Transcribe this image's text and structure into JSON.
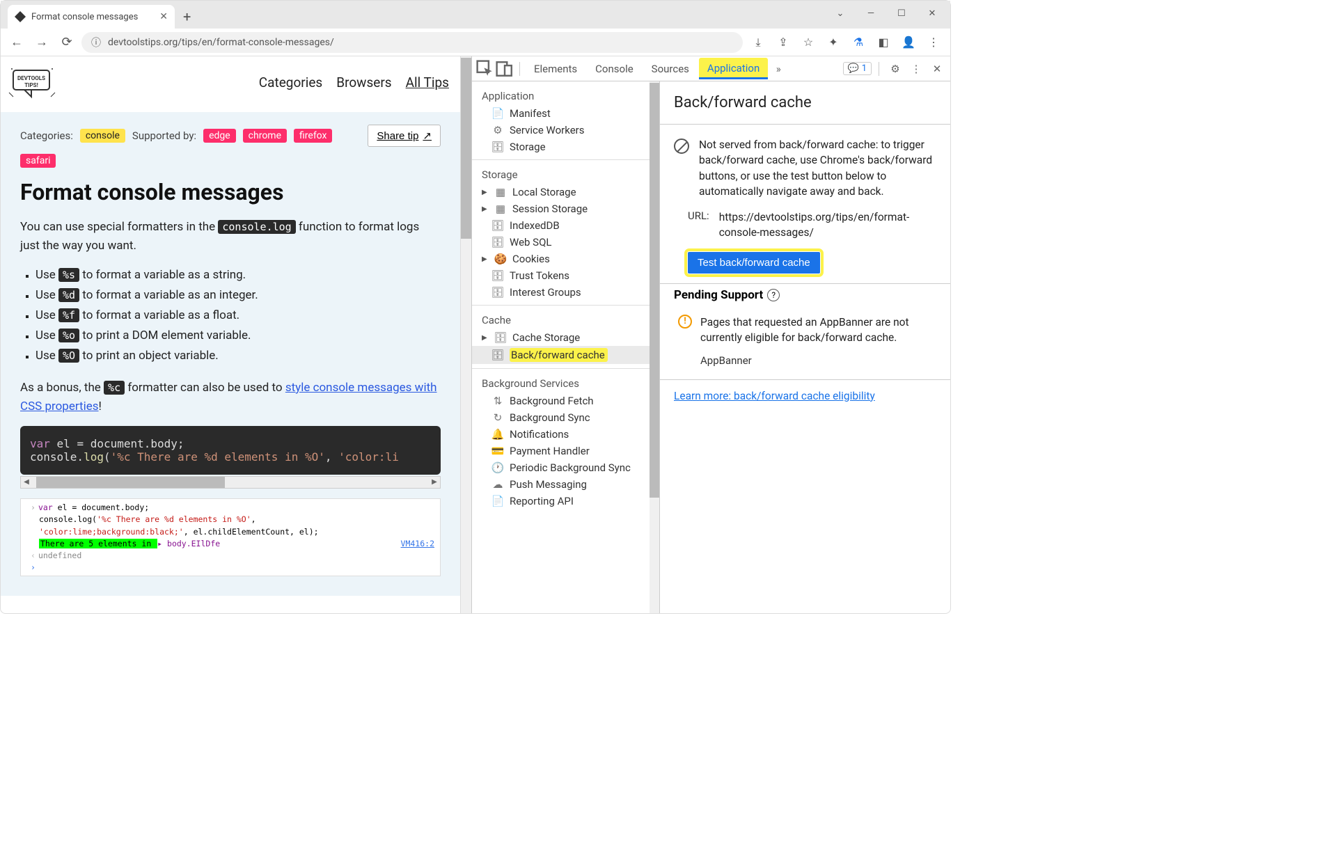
{
  "browser": {
    "tab_title": "Format console messages",
    "url_display": "devtoolstips.org/tips/en/format-console-messages/"
  },
  "page": {
    "nav": {
      "categories": "Categories",
      "browsers": "Browsers",
      "alltips": "All Tips"
    },
    "categories_label": "Categories:",
    "supported_label": "Supported by:",
    "tags": {
      "console": "console",
      "edge": "edge",
      "chrome": "chrome",
      "firefox": "firefox",
      "safari": "safari"
    },
    "share_tip": "Share tip",
    "title": "Format console messages",
    "intro_pre": "You can use special formatters in the ",
    "intro_code": "console.log",
    "intro_post": " function to format logs just the way you want.",
    "fmt": [
      {
        "pre": "Use ",
        "code": "%s",
        "post": " to format a variable as a string."
      },
      {
        "pre": "Use ",
        "code": "%d",
        "post": " to format a variable as an integer."
      },
      {
        "pre": "Use ",
        "code": "%f",
        "post": " to format a variable as a float."
      },
      {
        "pre": "Use ",
        "code": "%o",
        "post": " to print a DOM element variable."
      },
      {
        "pre": "Use ",
        "code": "%O",
        "post": " to print an object variable."
      }
    ],
    "bonus_pre": "As a bonus, the ",
    "bonus_code": "%c",
    "bonus_mid": " formatter can also be used to ",
    "bonus_link": "style console messages with CSS properties",
    "bonus_post": "!",
    "code_line1_kw": "var",
    "code_line1_rest": " el = document.body;",
    "code_line2_pre": "console.",
    "code_line2_fn": "log",
    "code_line2_str1": "'%c There are %d elements in %O'",
    "code_line2_str2": "'color:li",
    "console_out": {
      "line1": "var el = document.body;",
      "line2": "console.log('%c There are %d elements in %O',",
      "line3": "'color:lime;background:black;', el.childElementCount, el);",
      "green": " There are 5 elements in ",
      "body_token": "▸ body.EIlDfe",
      "vm": "VM416:2",
      "undef": "undefined"
    }
  },
  "devtools": {
    "tabs": {
      "elements": "Elements",
      "console": "Console",
      "sources": "Sources",
      "application": "Application"
    },
    "issues_count": "1",
    "sidebar": {
      "application": {
        "header": "Application",
        "manifest": "Manifest",
        "service_workers": "Service Workers",
        "storage": "Storage"
      },
      "storage": {
        "header": "Storage",
        "local": "Local Storage",
        "session": "Session Storage",
        "indexed": "IndexedDB",
        "websql": "Web SQL",
        "cookies": "Cookies",
        "trust": "Trust Tokens",
        "interest": "Interest Groups"
      },
      "cache": {
        "header": "Cache",
        "cache_storage": "Cache Storage",
        "bfcache": "Back/forward cache"
      },
      "bg": {
        "header": "Background Services",
        "fetch": "Background Fetch",
        "sync": "Background Sync",
        "notif": "Notifications",
        "payment": "Payment Handler",
        "periodic": "Periodic Background Sync",
        "push": "Push Messaging",
        "reporting": "Reporting API"
      }
    },
    "main": {
      "title": "Back/forward cache",
      "info": "Not served from back/forward cache: to trigger back/forward cache, use Chrome's back/forward buttons, or use the test button below to automatically navigate away and back.",
      "url_label": "URL:",
      "url_value": "https://devtoolstips.org/tips/en/format-console-messages/",
      "test_button": "Test back/forward cache",
      "pending_header": "Pending Support",
      "warn_text": "Pages that requested an AppBanner are not currently eligible for back/forward cache.",
      "appbanner": "AppBanner",
      "learn_more": "Learn more: back/forward cache eligibility"
    }
  }
}
